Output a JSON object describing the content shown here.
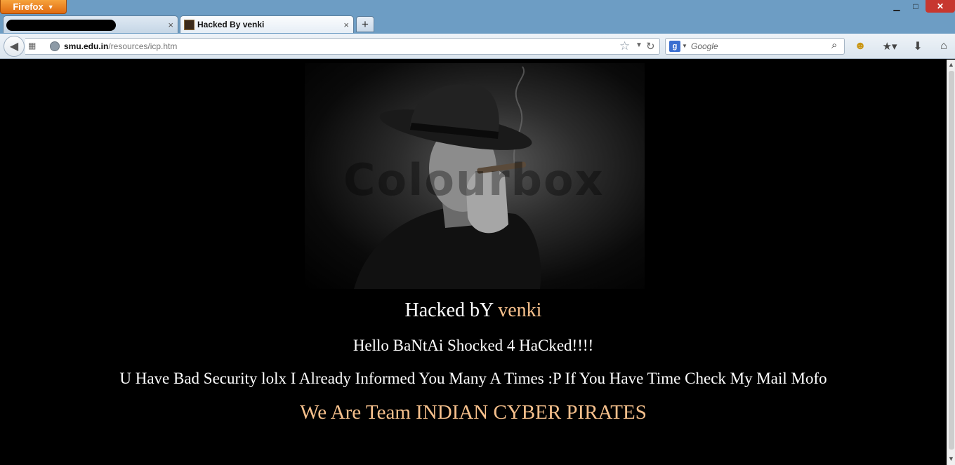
{
  "browser": {
    "app_button": "Firefox",
    "window_controls": {
      "minimize": "▁",
      "maximize": "□",
      "close": "✕"
    },
    "tabs": [
      {
        "title": "",
        "redacted": true
      },
      {
        "title": "Hacked By venki",
        "active": true
      }
    ],
    "new_tab": "+",
    "url": {
      "host": "smu.edu.in",
      "path": "/resources/icp.htm"
    },
    "search": {
      "engine": "Google",
      "placeholder": "Google"
    }
  },
  "page": {
    "heading_prefix": "Hacked bY ",
    "heading_name": "venki",
    "line2": "Hello BaNtAi Shocked 4 HaCked!!!!",
    "line3": "U Have Bad Security lolx I Already Informed You Many A Times :P If You Have Time Check My Mail Mofo",
    "line4": "We Are Team INDIAN CYBER PIRATES",
    "image_watermark": "Colourbox"
  },
  "colors": {
    "highlight": "#f6c08c",
    "background": "#000000",
    "firefox_orange": "#e06b10"
  }
}
